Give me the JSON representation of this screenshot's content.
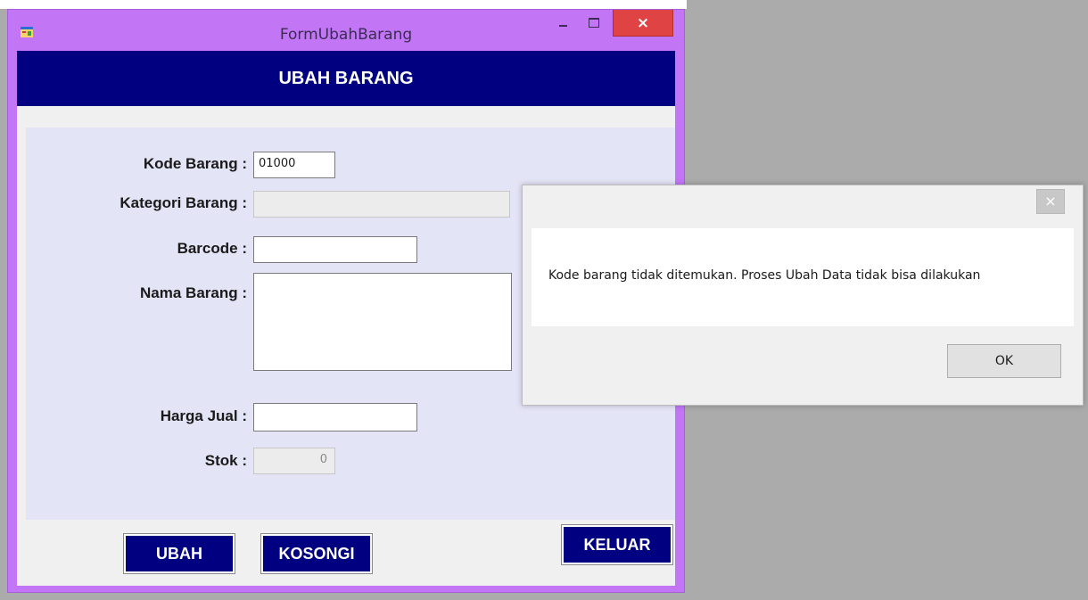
{
  "window": {
    "title": "FormUbahBarang",
    "close_glyph": "×",
    "icon": "app-form-icon"
  },
  "form": {
    "header": "UBAH BARANG",
    "fields": {
      "kode_barang": {
        "label": "Kode Barang :",
        "value": "01000"
      },
      "kategori_barang": {
        "label": "Kategori Barang :",
        "value": ""
      },
      "barcode": {
        "label": "Barcode :",
        "value": ""
      },
      "nama_barang": {
        "label": "Nama Barang :",
        "value": ""
      },
      "harga_jual": {
        "label": "Harga Jual :",
        "value": ""
      },
      "stok": {
        "label": "Stok :",
        "value": "0"
      }
    },
    "buttons": {
      "ubah": "UBAH",
      "kosongi": "KOSONGI",
      "keluar": "KELUAR"
    }
  },
  "message_box": {
    "close_glyph": "×",
    "text": "Kode barang tidak ditemukan. Proses Ubah Data tidak bisa dilakukan",
    "ok": "OK"
  },
  "colors": {
    "window_frame": "#c276f6",
    "header_band": "#000080",
    "form_panel": "#e4e4f7",
    "close_button": "#e04343",
    "desktop": "#ababab"
  }
}
